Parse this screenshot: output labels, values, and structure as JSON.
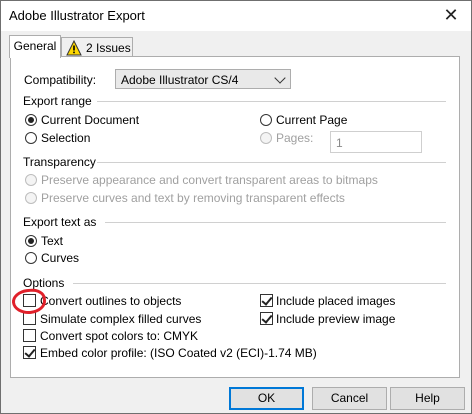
{
  "window": {
    "title": "Adobe Illustrator Export",
    "close_glyph": "✕"
  },
  "tabs": [
    {
      "label": "General",
      "active": true
    },
    {
      "label": "2 Issues",
      "icon": "warning-icon",
      "active": false
    }
  ],
  "compatibility": {
    "label": "Compatibility:",
    "value": "Adobe Illustrator CS/4"
  },
  "export_range": {
    "title": "Export range",
    "current_document": "Current Document",
    "selection": "Selection",
    "current_page": "Current Page",
    "pages_label": "Pages:",
    "pages_value": "1",
    "selected": "current_document"
  },
  "transparency": {
    "title": "Transparency",
    "option_1": "Preserve appearance and convert transparent areas to bitmaps",
    "option_2": "Preserve curves and text by removing transparent effects"
  },
  "export_text": {
    "title": "Export text as",
    "text": "Text",
    "curves": "Curves",
    "selected": "text"
  },
  "options": {
    "title": "Options",
    "convert_outlines": {
      "label": "Convert outlines to objects",
      "checked": false
    },
    "simulate_filled": {
      "label": "Simulate complex filled curves",
      "checked": false
    },
    "convert_spot": {
      "label": "Convert spot colors to: CMYK",
      "checked": false
    },
    "embed_profile": {
      "label": "Embed color profile:  (ISO Coated v2 (ECI)-1.74 MB)",
      "checked": true
    },
    "include_placed": {
      "label": "Include placed images",
      "checked": true
    },
    "include_preview": {
      "label": "Include preview image",
      "checked": true
    }
  },
  "buttons": {
    "ok": "OK",
    "cancel": "Cancel",
    "help": "Help"
  },
  "colors": {
    "focus_border": "#0078d7",
    "annotation": "#e0202a"
  }
}
